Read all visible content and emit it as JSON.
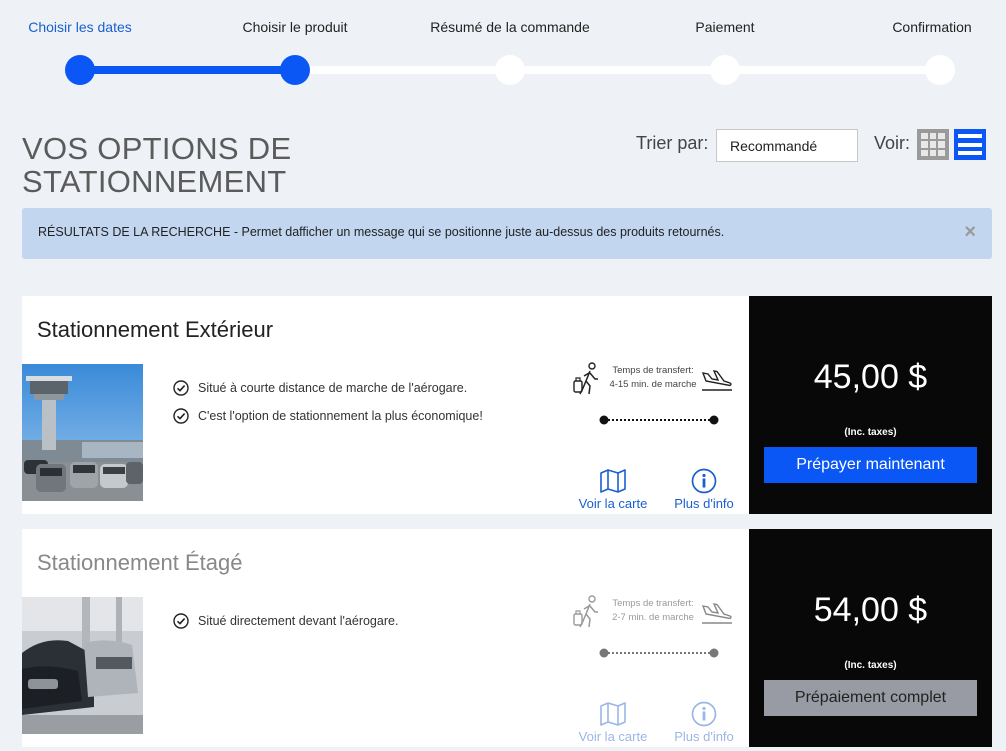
{
  "stepper": {
    "steps": [
      {
        "label": "Choisir les dates"
      },
      {
        "label": "Choisir le produit"
      },
      {
        "label": "Résumé de la commande"
      },
      {
        "label": "Paiement"
      },
      {
        "label": "Confirmation"
      }
    ]
  },
  "header": {
    "title": "VOS OPTIONS DE STATIONNEMENT",
    "sort_label": "Trier par:",
    "sort_value": "Recommandé",
    "view_label": "Voir:",
    "view_grid_icon": "grid-icon",
    "view_list_icon": "list-icon"
  },
  "alert": {
    "text": "RÉSULTATS DE LA RECHERCHE - Permet dafficher un message qui se positionne juste au-dessus des produits retournés.",
    "close": "×"
  },
  "products": [
    {
      "title": "Stationnement Extérieur",
      "features": [
        "Situé à courte distance de marche de l'aérogare.",
        "C'est l'option de stationnement la plus économique!"
      ],
      "transfer_label": "Temps de transfert:",
      "transfer_time": "4-15 min. de marche",
      "map_label": "Voir la carte",
      "info_label": "Plus d'info",
      "price": "45,00 $",
      "tax_note": "(Inc. taxes)",
      "button_label": "Prépayer maintenant"
    },
    {
      "title": "Stationnement Étagé",
      "features": [
        "Situé directement devant l'aérogare."
      ],
      "transfer_label": "Temps de transfert:",
      "transfer_time": "2-7 min. de marche",
      "map_label": "Voir la carte",
      "info_label": "Plus d'info",
      "price": "54,00 $",
      "tax_note": "(Inc. taxes)",
      "button_label": "Prépaiement complet"
    }
  ],
  "colors": {
    "accent": "#0b57f5",
    "background": "#eef1f6",
    "alert_bg": "#c3d6ef",
    "price_bg": "#080808",
    "disabled_button": "#989ba4"
  }
}
